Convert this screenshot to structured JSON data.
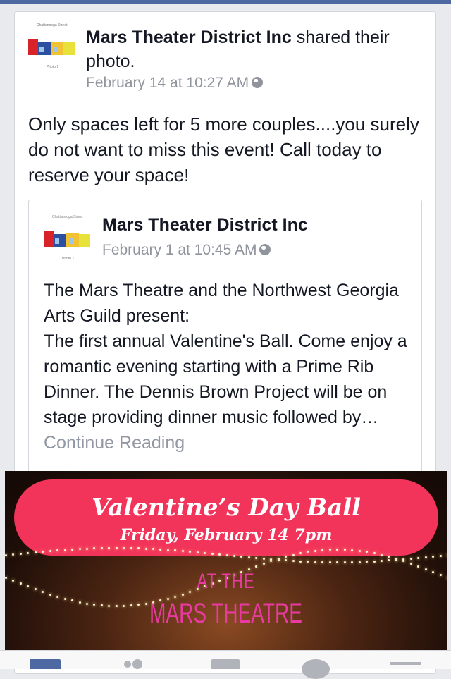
{
  "post": {
    "author": "Mars Theater District Inc",
    "action": " shared their photo.",
    "timestamp": "February 14 at 10:27 AM",
    "message": "Only spaces left for 5 more couples....you surely do not want to miss this event!  Call today to reserve your space!"
  },
  "shared": {
    "author": "Mars Theater District Inc",
    "timestamp": "February 1 at 10:45 AM",
    "text": "The Mars Theatre and the Northwest Georgia Arts Guild present:\nThe first annual Valentine's Ball. Come enjoy a romantic evening starting with a Prime Rib Dinner.  The Dennis Brown Project will be on stage providing dinner music followed by… ",
    "continue_label": "Continue Reading"
  },
  "banner": {
    "line1": "Valentine’s Day Ball",
    "line2": "Friday, February 14  7pm",
    "line3": "AT THE",
    "line4": "MARS THEATRE"
  },
  "avatar": {
    "caption_top": "Chattanooga Street",
    "caption_bottom": "Photo 1"
  },
  "icons": [
    "globe-icon",
    "news-feed-icon",
    "friend-requests-icon",
    "messages-icon",
    "notifications-icon",
    "more-icon"
  ],
  "colors": {
    "header_blue": "#4e69a2",
    "link_gray": "#9197a3",
    "banner_pink": "#f2345a",
    "tab_active": "#4e69a2"
  }
}
